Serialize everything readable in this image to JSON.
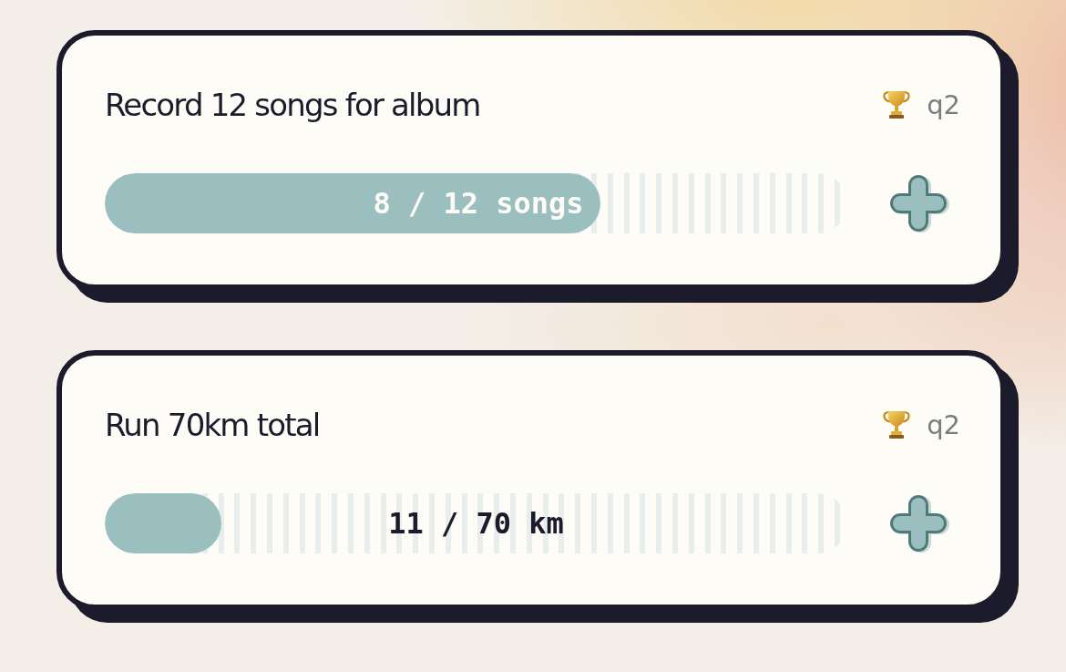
{
  "goals": [
    {
      "title": "Record 12 songs for album",
      "tag": "q2",
      "level": 0.667,
      "progress_label": "8 / 12 songs"
    },
    {
      "title": "Run 70km total",
      "tag": "q2",
      "level": 0.157,
      "progress_label": "11 / 70 km"
    }
  ]
}
